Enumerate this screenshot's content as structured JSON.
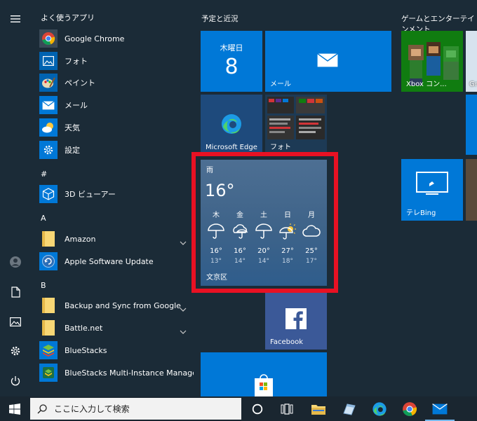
{
  "rail": {
    "icons": [
      "hamburger-icon",
      "user-icon",
      "document-icon",
      "pictures-icon",
      "settings-icon",
      "power-icon"
    ]
  },
  "applist": {
    "section": "よく使うアプリ",
    "frequent": [
      {
        "label": "Google Chrome",
        "icon": "chrome-icon"
      },
      {
        "label": "フォト",
        "icon": "photos-icon"
      },
      {
        "label": "ペイント",
        "icon": "paint-icon"
      },
      {
        "label": "メール",
        "icon": "mail-icon"
      },
      {
        "label": "天気",
        "icon": "weather-icon"
      },
      {
        "label": "設定",
        "icon": "settings-icon"
      }
    ],
    "letters": [
      "#",
      "A",
      "B"
    ],
    "hash_apps": [
      {
        "label": "3D ビューアー",
        "icon": "3d-viewer-icon"
      }
    ],
    "a_apps": [
      {
        "label": "Amazon",
        "icon": "folder-icon"
      },
      {
        "label": "Apple Software Update",
        "icon": "apple-update-icon"
      }
    ],
    "b_apps": [
      {
        "label": "Backup and Sync from Google",
        "icon": "folder-icon"
      },
      {
        "label": "Battle.net",
        "icon": "folder-icon"
      },
      {
        "label": "BlueStacks",
        "icon": "bluestacks-icon"
      },
      {
        "label": "BlueStacks Multi-Instance Manager",
        "icon": "bluestacks-multi-icon"
      }
    ]
  },
  "groups": {
    "schedule": "予定と近況",
    "games": "ゲームとエンターテインメント"
  },
  "tiles": {
    "calendar_day": "木曜日",
    "calendar_date": "8",
    "mail": "メール",
    "edge": "Microsoft Edge",
    "photos": "フォト",
    "xbox": "Xbox コン...",
    "tvbing": "テレBing",
    "facebook": "Facebook",
    "partial_g": "Gr"
  },
  "weather": {
    "condition": "雨",
    "temp": "16°",
    "location": "文京区",
    "days": [
      {
        "day": "木",
        "hi": "16°",
        "lo": "13°",
        "icon": "umbrella-icon"
      },
      {
        "day": "金",
        "hi": "16°",
        "lo": "14°",
        "icon": "cloud-rain-icon"
      },
      {
        "day": "土",
        "hi": "20°",
        "lo": "14°",
        "icon": "umbrella-icon"
      },
      {
        "day": "日",
        "hi": "27°",
        "lo": "18°",
        "icon": "sun-rain-icon"
      },
      {
        "day": "月",
        "hi": "25°",
        "lo": "17°",
        "icon": "cloud-icon"
      }
    ]
  },
  "taskbar": {
    "search_placeholder": "ここに入力して検索",
    "icons": [
      "start-icon",
      "cortana-icon",
      "task-view-icon",
      "file-explorer-icon",
      "app-icon",
      "edge-icon",
      "chrome-icon",
      "mail-icon"
    ]
  },
  "colors": {
    "tile_blue": "#0078d7",
    "highlight": "#e81123",
    "background": "#1b2b37"
  }
}
